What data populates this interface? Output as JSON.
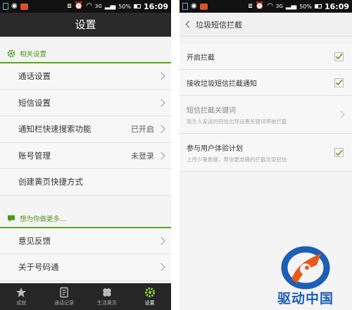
{
  "status_bar": {
    "battery": "50%",
    "time": "16:09",
    "network": "3G"
  },
  "left": {
    "title": "设置",
    "section1": {
      "title": "相关设置",
      "items": [
        {
          "label": "通话设置",
          "value": ""
        },
        {
          "label": "短信设置",
          "value": ""
        },
        {
          "label": "通知栏快速搜索功能",
          "value": "已开启"
        },
        {
          "label": "账号管理",
          "value": "未登录"
        },
        {
          "label": "创建黄页快捷方式",
          "value": ""
        }
      ]
    },
    "section2": {
      "title": "想为你做更多...",
      "items": [
        {
          "label": "意见反馈"
        },
        {
          "label": "关于号码通"
        }
      ]
    },
    "nav": [
      {
        "label": "成就",
        "icon": "star-icon"
      },
      {
        "label": "通话记录",
        "icon": "call-log-icon"
      },
      {
        "label": "生活黄页",
        "icon": "clover-icon"
      },
      {
        "label": "设置",
        "icon": "gear-icon",
        "active": true
      }
    ]
  },
  "right": {
    "title": "垃圾短信拦截",
    "items": [
      {
        "label": "开启拦截",
        "checked": true
      },
      {
        "label": "接收垃圾短信拦截通知",
        "checked": true
      },
      {
        "label": "短信拦截关键词",
        "sub": "陌生人发送的短信出现设置关键词将被拦截"
      },
      {
        "label": "参与用户体验计划",
        "sub": "上传少量数据，帮你更准确的拦截垃圾短信",
        "checked": true
      }
    ]
  },
  "watermark": {
    "text": "驱动中国"
  },
  "colors": {
    "accent_green": "#56a81c",
    "logo_blue": "#1c5fb4",
    "logo_orange": "#e85a1b"
  }
}
